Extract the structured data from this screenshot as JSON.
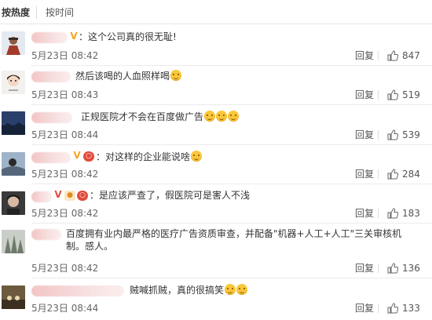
{
  "sort": {
    "hot": "按热度",
    "time": "按时间"
  },
  "comments": [
    {
      "text": "：这个公司真的很无耻!",
      "emojis": 0,
      "time": "5月23日 08:42",
      "likes": "847"
    },
    {
      "text": "然后该喝的人血照样喝",
      "emojis": 1,
      "time": "5月23日 08:43",
      "likes": "519"
    },
    {
      "text": "正规医院才不会在百度做广告",
      "emojis": 3,
      "time": "5月23日 08:44",
      "likes": "539"
    },
    {
      "text": "：对这样的企业能说啥",
      "emojis": 1,
      "time": "5月23日 08:42",
      "likes": "284"
    },
    {
      "text": "：是应该严查了，假医院可是害人不浅",
      "emojis": 0,
      "time": "5月23日 08:42",
      "likes": "183"
    },
    {
      "text": "百度拥有业内最严格的医疗广告资质审查，并配备\"机器+人工+人工\"三关审核机制。感人。",
      "emojis": 0,
      "time": "5月23日 08:42",
      "likes": "136"
    },
    {
      "text": "贼喊抓贼，真的很搞笑",
      "emojis": 2,
      "time": "5月23日 08:44",
      "likes": "133"
    }
  ],
  "labels": {
    "reply": "回复"
  },
  "colors": {
    "name_blur": "#f2c5c5",
    "vip_badge": "#f5a623",
    "red_badge": "#e24b3b"
  }
}
